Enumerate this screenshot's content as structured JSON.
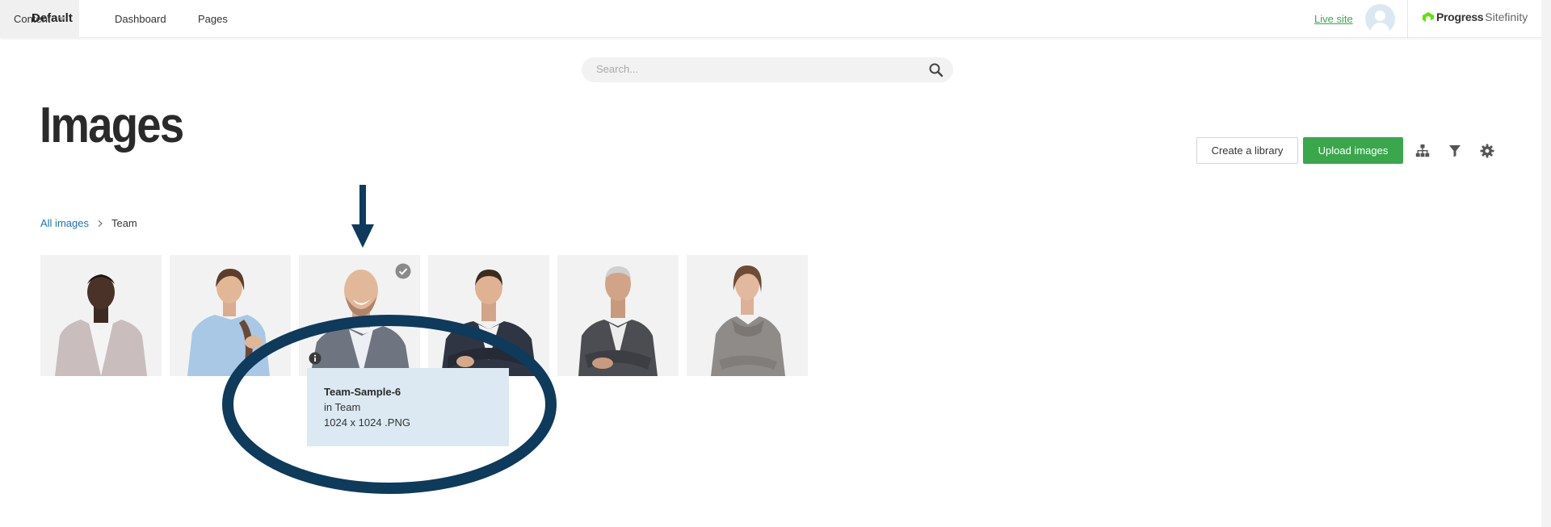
{
  "topbar": {
    "site_name": "Default",
    "nav": [
      {
        "label": "Dashboard"
      },
      {
        "label": "Pages"
      },
      {
        "label": "Content"
      }
    ],
    "live_site_label": "Live site",
    "brand": {
      "progress": "Progress",
      "sitefinity": "Sitefinity"
    }
  },
  "search": {
    "placeholder": "Search...",
    "value": ""
  },
  "page": {
    "title": "Images"
  },
  "toolbar": {
    "create_library_label": "Create a library",
    "upload_images_label": "Upload images",
    "icons": [
      "hierarchy-icon",
      "filter-icon",
      "gear-icon"
    ]
  },
  "breadcrumb": {
    "root": "All images",
    "current": "Team"
  },
  "images": [
    {
      "kind": "man-blazer-plaid"
    },
    {
      "kind": "woman-blue-shirt"
    },
    {
      "kind": "bald-man-laughing",
      "selected": true
    },
    {
      "kind": "man-suit-arms-crossed"
    },
    {
      "kind": "older-man-seated"
    },
    {
      "kind": "woman-grey-sweater"
    }
  ],
  "tooltip": {
    "name": "Team-Sample-6",
    "library": "in Team",
    "dimensions": "1024 x 1024 .PNG"
  },
  "colors": {
    "accent_green": "#3aa74d",
    "link_blue": "#1a73b5",
    "annotation_navy": "#0e3a5c",
    "tooltip_bg": "#dce9f2"
  }
}
